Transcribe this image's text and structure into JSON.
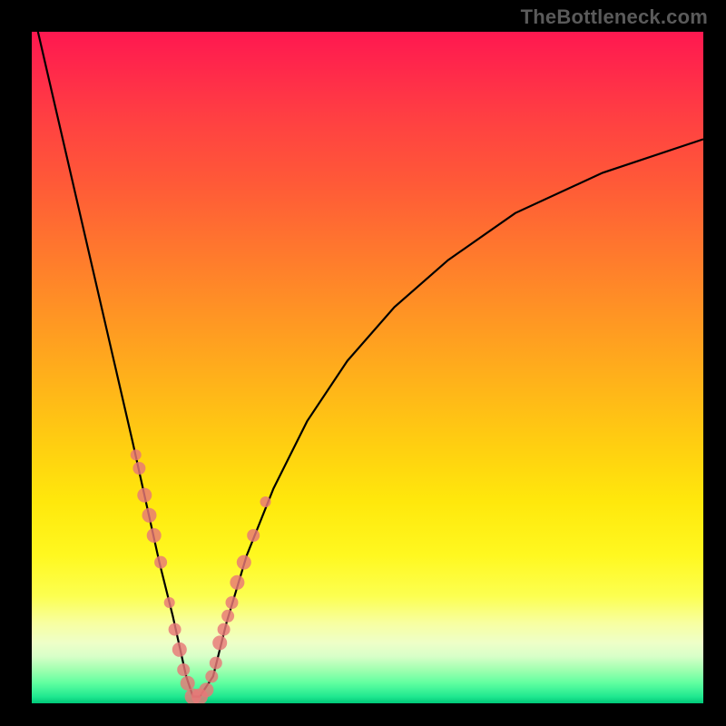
{
  "source_label": "TheBottleneck.com",
  "colors": {
    "marker": "#e87878",
    "curve": "#000000"
  },
  "chart_data": {
    "type": "line",
    "title": "",
    "xlabel": "",
    "ylabel": "",
    "xlim": [
      0,
      100
    ],
    "ylim": [
      0,
      100
    ],
    "grid": false,
    "axes_visible": false,
    "note": "Unlabeled bottleneck curve. x is an implicit component-ratio axis; y is bottleneck percentage (0 at bottom, 100 at top). Values are read off pixel positions; minimum ≈0 near x≈24.",
    "series": [
      {
        "name": "bottleneck_curve",
        "x": [
          0,
          3,
          6,
          9,
          12,
          15,
          17,
          19,
          21,
          23,
          24,
          25,
          27,
          29,
          32,
          36,
          41,
          47,
          54,
          62,
          72,
          85,
          100
        ],
        "y": [
          104,
          91,
          78,
          65,
          52,
          39,
          30,
          21,
          13,
          4,
          1,
          1,
          4,
          12,
          22,
          32,
          42,
          51,
          59,
          66,
          73,
          79,
          84
        ]
      }
    ],
    "markers": {
      "name": "highlighted_points",
      "x": [
        15.5,
        16,
        16.8,
        17.5,
        18.2,
        19.2,
        20.5,
        21.3,
        22.0,
        22.6,
        23.2,
        24.0,
        25.0,
        26.0,
        26.8,
        27.4,
        28.0,
        28.6,
        29.2,
        29.8,
        30.6,
        31.6,
        33.0,
        34.8
      ],
      "y": [
        37,
        35,
        31,
        28,
        25,
        21,
        15,
        11,
        8,
        5,
        3,
        1,
        1,
        2,
        4,
        6,
        9,
        11,
        13,
        15,
        18,
        21,
        25,
        30
      ],
      "r": [
        6,
        7,
        8,
        8,
        8,
        7,
        6,
        7,
        8,
        7,
        8,
        9,
        9,
        8,
        7,
        7,
        8,
        7,
        7,
        7,
        8,
        8,
        7,
        6
      ]
    }
  }
}
